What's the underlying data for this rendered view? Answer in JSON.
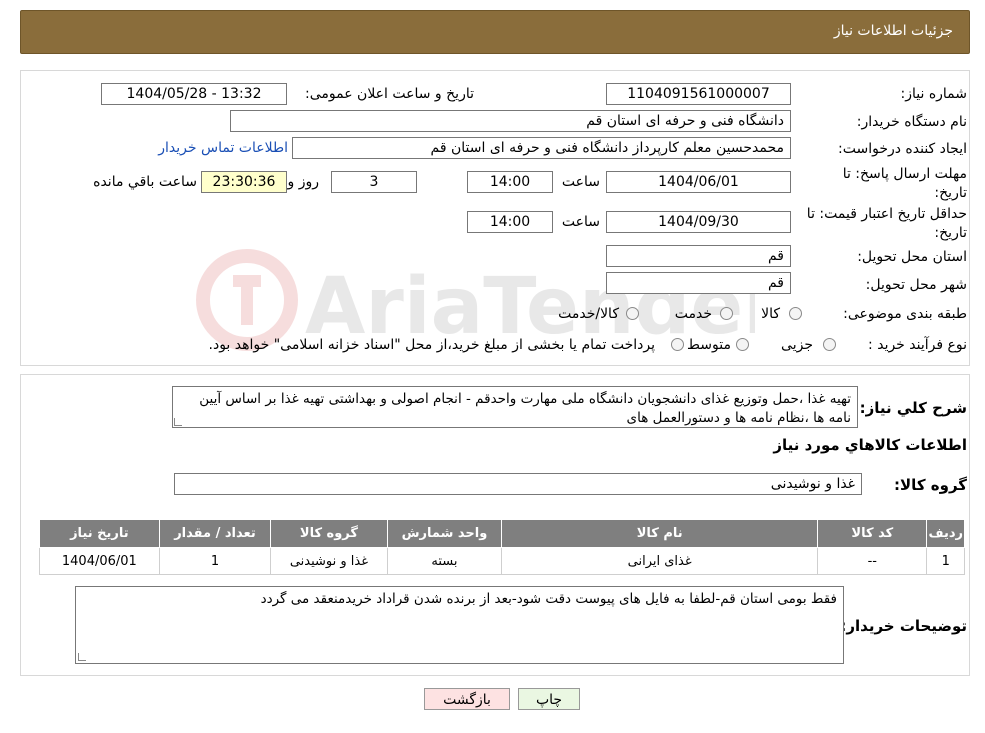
{
  "header": {
    "title": "جزئیات اطلاعات نیاز"
  },
  "form": {
    "need_number_label": "شماره نیاز:",
    "need_number": "1104091561000007",
    "announce_label": "تاریخ و ساعت اعلان عمومی:",
    "announce_value": "1404/05/28 - 13:32",
    "buyer_org_label": "نام دستگاه خریدار:",
    "buyer_org": "دانشگاه فنی و حرفه ای استان قم",
    "creator_label": "ایجاد کننده درخواست:",
    "creator": "محمدحسین معلم کارپرداز دانشگاه فنی و حرفه ای استان قم",
    "contact_link": "اطلاعات تماس خریدار",
    "deadline_label_1": "مهلت ارسال پاسخ: تا",
    "deadline_label_2": "تاریخ:",
    "deadline_date": "1404/06/01",
    "time_label": "ساعت",
    "deadline_time": "14:00",
    "days_value": "3",
    "days_label": "روز و",
    "remaining_time": "23:30:36",
    "remaining_label": "ساعت باقي مانده",
    "validity_label_1": "حداقل تاریخ اعتبار قیمت: تا",
    "validity_label_2": "تاریخ:",
    "validity_date": "1404/09/30",
    "validity_time": "14:00",
    "province_label": "استان محل تحویل:",
    "province": "قم",
    "city_label": "شهر محل تحویل:",
    "city": "قم",
    "category_label": "طبقه بندی موضوعی:",
    "category_options": [
      "کالا",
      "خدمت",
      "کالا/خدمت"
    ],
    "process_label": "نوع فرآیند خرید :",
    "process_options": [
      "جزیی",
      "متوسط"
    ],
    "process_note": "پرداخت تمام یا بخشی از مبلغ خرید،از محل \"اسناد خزانه اسلامی\" خواهد بود."
  },
  "details": {
    "summary_label": "شرح کلي نياز:",
    "summary_text": "تهیه غذا ،حمل وتوزیع غذای دانشجویان دانشگاه ملی مهارت واحدقم - انجام اصولی و بهداشتی تهیه غذا بر اساس آیین نامه ها ،نظام نامه ها و دستورالعمل های",
    "goods_info_title": "اطلاعات کالاهاي مورد نياز",
    "goods_group_label": "گروه کالا:",
    "goods_group": "غذا و نوشیدنی",
    "table": {
      "headers": [
        "ردیف",
        "کد کالا",
        "نام کالا",
        "واحد شمارش",
        "گروه کالا",
        "تعداد / مقدار",
        "تاریخ نیاز"
      ],
      "rows": [
        [
          "1",
          "--",
          "غذای ایرانی",
          "بسته",
          "غذا و نوشیدنی",
          "1",
          "1404/06/01"
        ]
      ]
    },
    "buyer_notes_label": "توضیحات خریدار:",
    "buyer_notes": "فقط بومی استان قم-لطفا به فایل های پیوست دقت شود-بعد از برنده شدن قراداد خریدمنعقد می گردد"
  },
  "buttons": {
    "print": "چاپ",
    "back": "بازگشت"
  },
  "colors": {
    "header_bg": "#8a6d3b",
    "table_header_bg": "#7f7f7f",
    "link": "#1a4fb5",
    "remaining_bg": "#ffffcc",
    "back_bg": "#fde2e2",
    "print_bg": "#eaf7e2"
  }
}
